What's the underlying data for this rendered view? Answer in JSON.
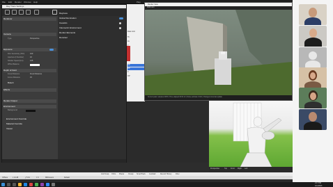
{
  "bg_menu": [
    "File",
    "Edit",
    "Render",
    "Window",
    "Help",
    "Play"
  ],
  "right_panel_rows": [
    "Data Grid",
    "Tb",
    "Ax",
    "7",
    "OP",
    "OP",
    "0",
    "OP"
  ],
  "settings": {
    "title": "Ray Trace Settings",
    "left_sections": [
      {
        "label": "Renderer",
        "header": true
      },
      {
        "label": "Camera",
        "header": true
      },
      {
        "label": "Exposure",
        "header": true
      },
      {
        "label": "Depth of Field",
        "header": true
      },
      {
        "label": "Bokeh",
        "header": false
      },
      {
        "label": "Effects",
        "header": true
      },
      {
        "label": "Render Output",
        "header": true
      },
      {
        "label": "Environment",
        "header": true
      },
      {
        "label": "Environment Override",
        "header": false
      },
      {
        "label": "Material Override",
        "header": false
      },
      {
        "label": "Viewer",
        "header": false
      }
    ],
    "left_fields": [
      {
        "label": "Type",
        "value": "Perspective"
      },
      {
        "label": "Film Sensitivity (ISO)",
        "value": "100"
      },
      {
        "label": "Aperture (f-Number)",
        "value": "16"
      },
      {
        "label": "Shutter Speed (1/s)",
        "value": "125"
      },
      {
        "label": "White Balance",
        "value": ""
      },
      {
        "label": "Focal Distance",
        "value": "Fixed Distance"
      },
      {
        "label": "Focus Distance",
        "value": "15"
      },
      {
        "label": "Background",
        "value": ""
      }
    ],
    "right_sections": [
      "Raytrace",
      "Global Illumination",
      "Caustics",
      "Volumetric Environment",
      "Render Elements",
      "Denoiser"
    ]
  },
  "render_window": {
    "title": "Render View",
    "tool_label": "RGB color",
    "status": "Current pass: samples 24/50 | Time elapsed 00:01:12 | Noise estimate 0.021 | Changes since last update"
  },
  "viewport_tabs": [
    "Perspective",
    "Top",
    "Front",
    "Right",
    "Left"
  ],
  "lower_bar_1": [
    "Grid Snap",
    "Ortho",
    "Planar",
    "Osnap",
    "SmartTrack",
    "Gumball",
    "Record History",
    "Filter"
  ],
  "lower_bar_2": [
    "CPlane",
    "x 14.48",
    "y 5.31",
    "z 0",
    "Millimeters",
    "Default"
  ],
  "colors": {
    "accent": "#4a90d9",
    "panel": "#353535",
    "status_green": "#9a9"
  },
  "taskbar": {
    "time": "2:17 PM",
    "date": "4/14/2021"
  }
}
